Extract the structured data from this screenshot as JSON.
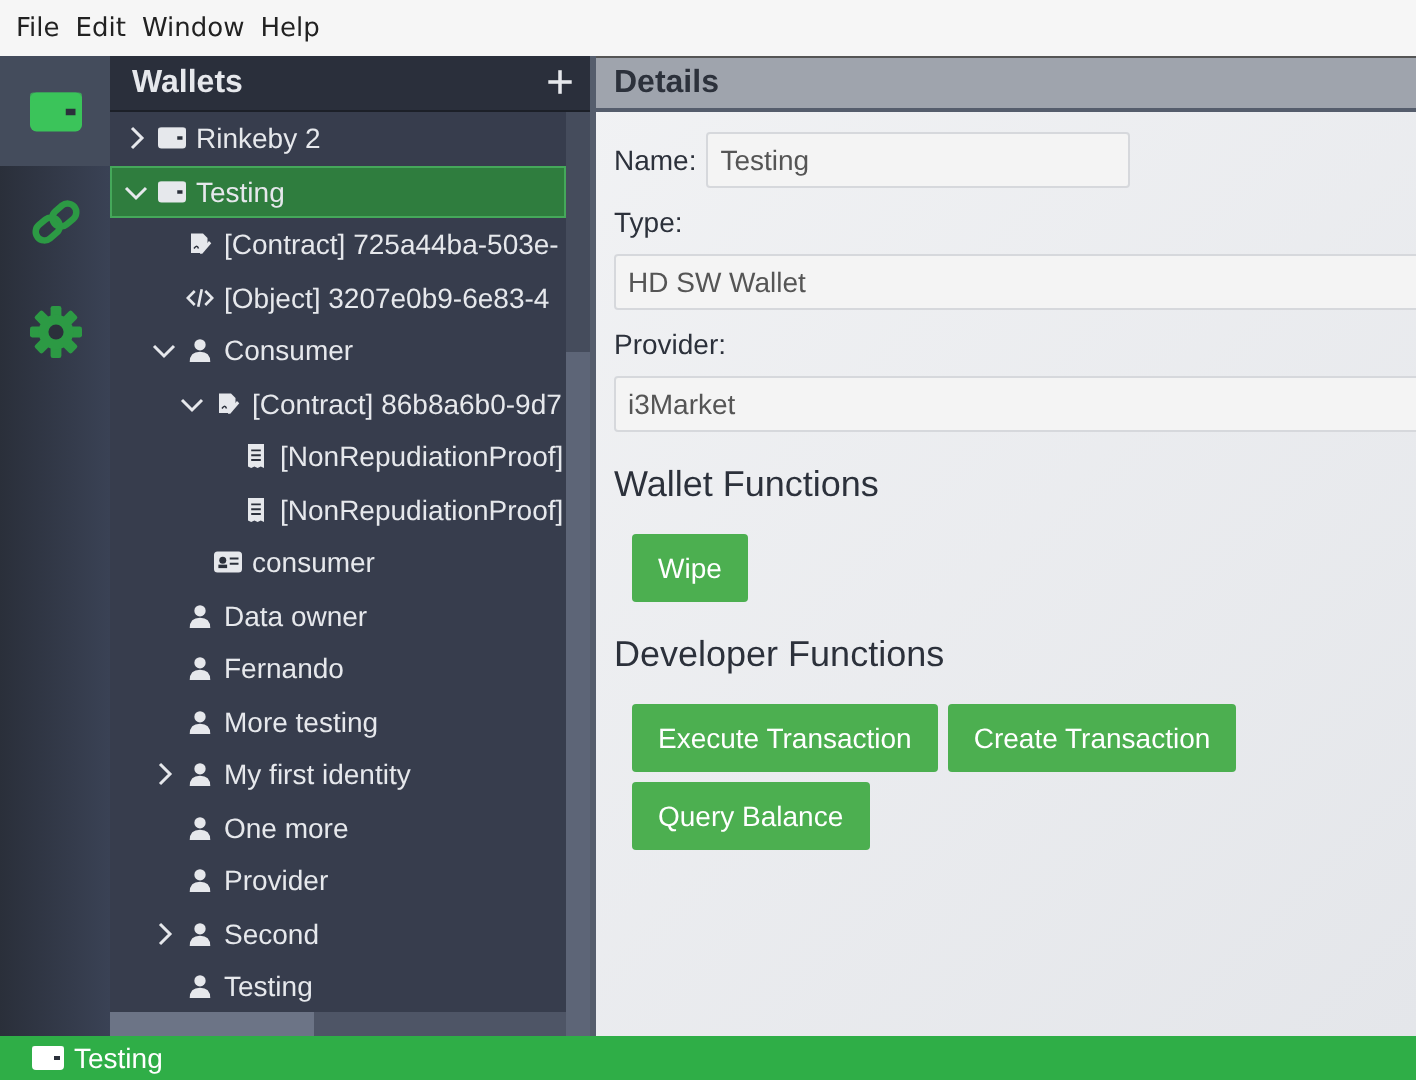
{
  "menu": [
    "File",
    "Edit",
    "Window",
    "Help"
  ],
  "rail": [
    {
      "kind": "wallet",
      "selected": true
    },
    {
      "kind": "link",
      "selected": false
    },
    {
      "kind": "settings",
      "selected": false
    }
  ],
  "tree": {
    "title": "Wallets",
    "add": "+",
    "items": [
      {
        "kind": "wallet",
        "label": "Rinkeby 2",
        "expanded": false,
        "selected": false
      },
      {
        "kind": "wallet",
        "label": "Testing",
        "expanded": true,
        "selected": true,
        "children": [
          {
            "kind": "contract",
            "label": "[Contract] 725a44ba-503e-",
            "selected": false
          },
          {
            "kind": "object",
            "label": "[Object] 3207e0b9-6e83-4",
            "selected": false
          },
          {
            "kind": "identity",
            "label": "Consumer",
            "expanded": true,
            "selected": false,
            "children": [
              {
                "kind": "contract",
                "label": "[Contract] 86b8a6b0-9d7",
                "expanded": true,
                "selected": false,
                "children": [
                  {
                    "kind": "proof",
                    "label": "[NonRepudiationProof]",
                    "selected": false
                  },
                  {
                    "kind": "proof",
                    "label": "[NonRepudiationProof]",
                    "selected": false
                  }
                ]
              },
              {
                "kind": "credential",
                "label": "consumer",
                "selected": false
              }
            ]
          },
          {
            "kind": "identity",
            "label": "Data owner",
            "selected": false
          },
          {
            "kind": "identity",
            "label": "Fernando",
            "selected": false
          },
          {
            "kind": "identity",
            "label": "More testing",
            "selected": false
          },
          {
            "kind": "identity",
            "label": "My first identity",
            "expanded": false,
            "selected": false
          },
          {
            "kind": "identity",
            "label": "One more",
            "selected": false
          },
          {
            "kind": "identity",
            "label": "Provider",
            "selected": false
          },
          {
            "kind": "identity",
            "label": "Second",
            "expanded": false,
            "selected": false
          },
          {
            "kind": "identity",
            "label": "Testing",
            "selected": false
          }
        ]
      }
    ]
  },
  "details": {
    "title": "Details",
    "name": {
      "label": "Name:",
      "value": "Testing"
    },
    "type": {
      "label": "Type:",
      "value": "HD SW Wallet"
    },
    "provider": {
      "label": "Provider:",
      "value": "i3Market"
    },
    "sections": [
      {
        "title": "Wallet Functions",
        "buttons": [
          "Wipe"
        ]
      },
      {
        "title": "Developer Functions",
        "buttons": [
          "Execute Transaction",
          "Create Transaction",
          "Query Balance"
        ]
      }
    ]
  },
  "status_bar": {
    "label": "Testing"
  }
}
